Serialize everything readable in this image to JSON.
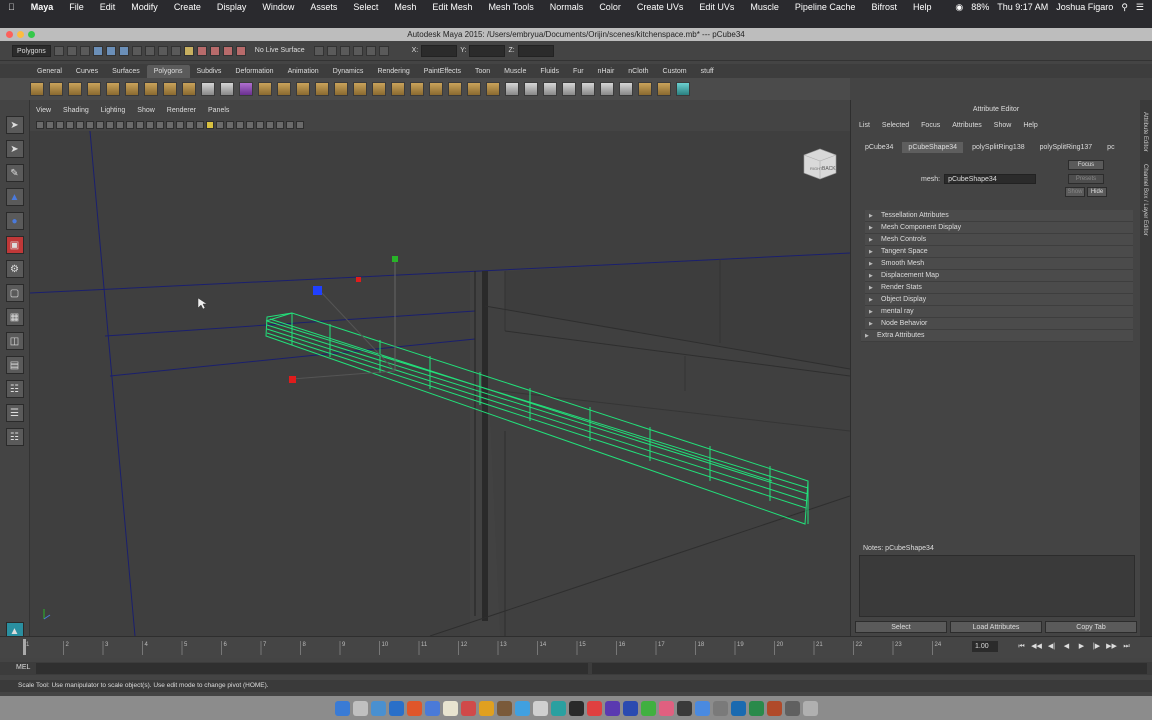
{
  "macbar": {
    "apple": "",
    "app": "Maya",
    "menus": [
      "File",
      "Edit",
      "Modify",
      "Create",
      "Display",
      "Window",
      "Assets",
      "Select",
      "Mesh",
      "Edit Mesh",
      "Mesh Tools",
      "Normals",
      "Color",
      "Create UVs",
      "Edit UVs",
      "Muscle",
      "Pipeline Cache",
      "Bifrost",
      "Help"
    ],
    "battery": "88%",
    "clock": "Thu 9:17 AM",
    "user": "Joshua Figaro"
  },
  "window": {
    "title": "Autodesk Maya 2015: /Users/embryua/Documents/Orijin/scenes/kitchenspace.mb*  ---  pCube34"
  },
  "statusline": {
    "mode": "Polygons",
    "live_surface": "No Live Surface",
    "x_label": "X:",
    "y_label": "Y:",
    "z_label": "Z:"
  },
  "shelf": {
    "tabs": [
      "General",
      "Curves",
      "Surfaces",
      "Polygons",
      "Subdivs",
      "Deformation",
      "Animation",
      "Dynamics",
      "Rendering",
      "PaintEffects",
      "Toon",
      "Muscle",
      "Fluids",
      "Fur",
      "nHair",
      "nCloth",
      "Custom",
      "stuff"
    ],
    "active_tab": "Polygons"
  },
  "panel": {
    "menus": [
      "View",
      "Shading",
      "Lighting",
      "Show",
      "Renderer",
      "Panels"
    ],
    "viewcube_label": "BACK",
    "viewcube_side": "RIGHT"
  },
  "attribute_editor": {
    "title": "Attribute Editor",
    "menus": [
      "List",
      "Selected",
      "Focus",
      "Attributes",
      "Show",
      "Help"
    ],
    "tabs": [
      "pCube34",
      "pCubeShape34",
      "polySplitRing138",
      "polySplitRing137",
      "pc"
    ],
    "active_tab": "pCubeShape34",
    "mesh_label": "mesh:",
    "mesh_value": "pCubeShape34",
    "focus_button": "Focus",
    "presets_button": "Presets",
    "show_button": "Show",
    "hide_button": "Hide",
    "sections": [
      "Tessellation Attributes",
      "Mesh Component Display",
      "Mesh Controls",
      "Tangent Space",
      "Smooth Mesh",
      "Displacement Map",
      "Render Stats",
      "Object Display",
      "mental ray",
      "Node Behavior"
    ],
    "extra_section": "Extra Attributes",
    "notes_label": "Notes:  pCubeShape34",
    "bottom_buttons": [
      "Select",
      "Load Attributes",
      "Copy Tab"
    ],
    "side_tabs": [
      "Attribute Editor",
      "Channel Box / Layer Editor"
    ]
  },
  "timeline": {
    "ticks": [
      "1",
      "2",
      "3",
      "4",
      "5",
      "6",
      "7",
      "8",
      "9",
      "10",
      "11",
      "12",
      "13",
      "14",
      "15",
      "16",
      "17",
      "18",
      "19",
      "20",
      "21",
      "22",
      "23",
      "24"
    ],
    "current_time": "1.00"
  },
  "mel": {
    "label": "MEL"
  },
  "helpline": {
    "text": "Scale Tool: Use manipulator to scale object(s). Use edit mode to change pivot (HOME)."
  },
  "colors": {
    "wire_green": "#22e07a",
    "manip_blue": "#2040ff",
    "manip_red": "#e01c1c",
    "manip_green": "#28b428",
    "grid_blue": "#1a1f6e"
  }
}
